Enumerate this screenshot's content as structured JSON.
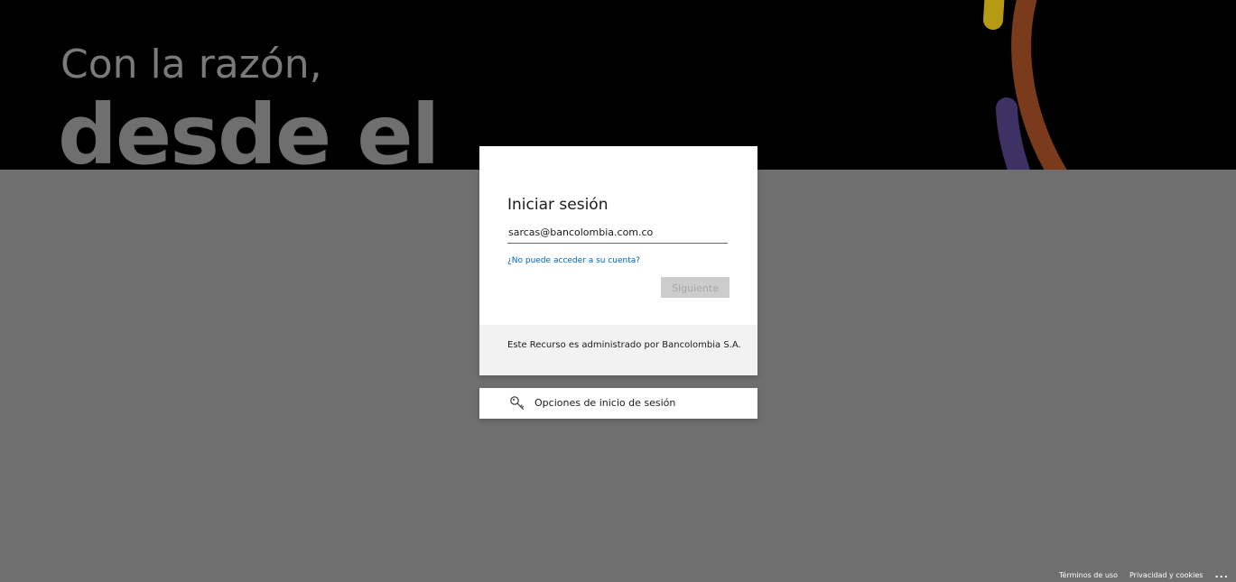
{
  "hero": {
    "line1": "Con la razón,",
    "line2": "desde el"
  },
  "signin": {
    "title": "Iniciar sesión",
    "email_value": "sarcas@bancolombia.com.co",
    "cant_access_link": "¿No puede acceder a su cuenta?",
    "next_button": "Siguiente",
    "footer_text": "Este Recurso es administrado por Bancolombia S.A."
  },
  "options": {
    "label": "Opciones de inicio de sesión",
    "icon": "key-icon"
  },
  "footer": {
    "terms": "Términos de uso",
    "privacy": "Privacidad y cookies",
    "more": "..."
  },
  "colors": {
    "hero_bg": "#000000",
    "overlay_bg": "#6f6f6f",
    "link": "#0067b8",
    "button_disabled": "#cccccc",
    "card_footer_bg": "#f2f2f2",
    "art_yellow": "#b59a14",
    "art_orange": "#7a3a1c",
    "art_purple": "#3e3264"
  }
}
